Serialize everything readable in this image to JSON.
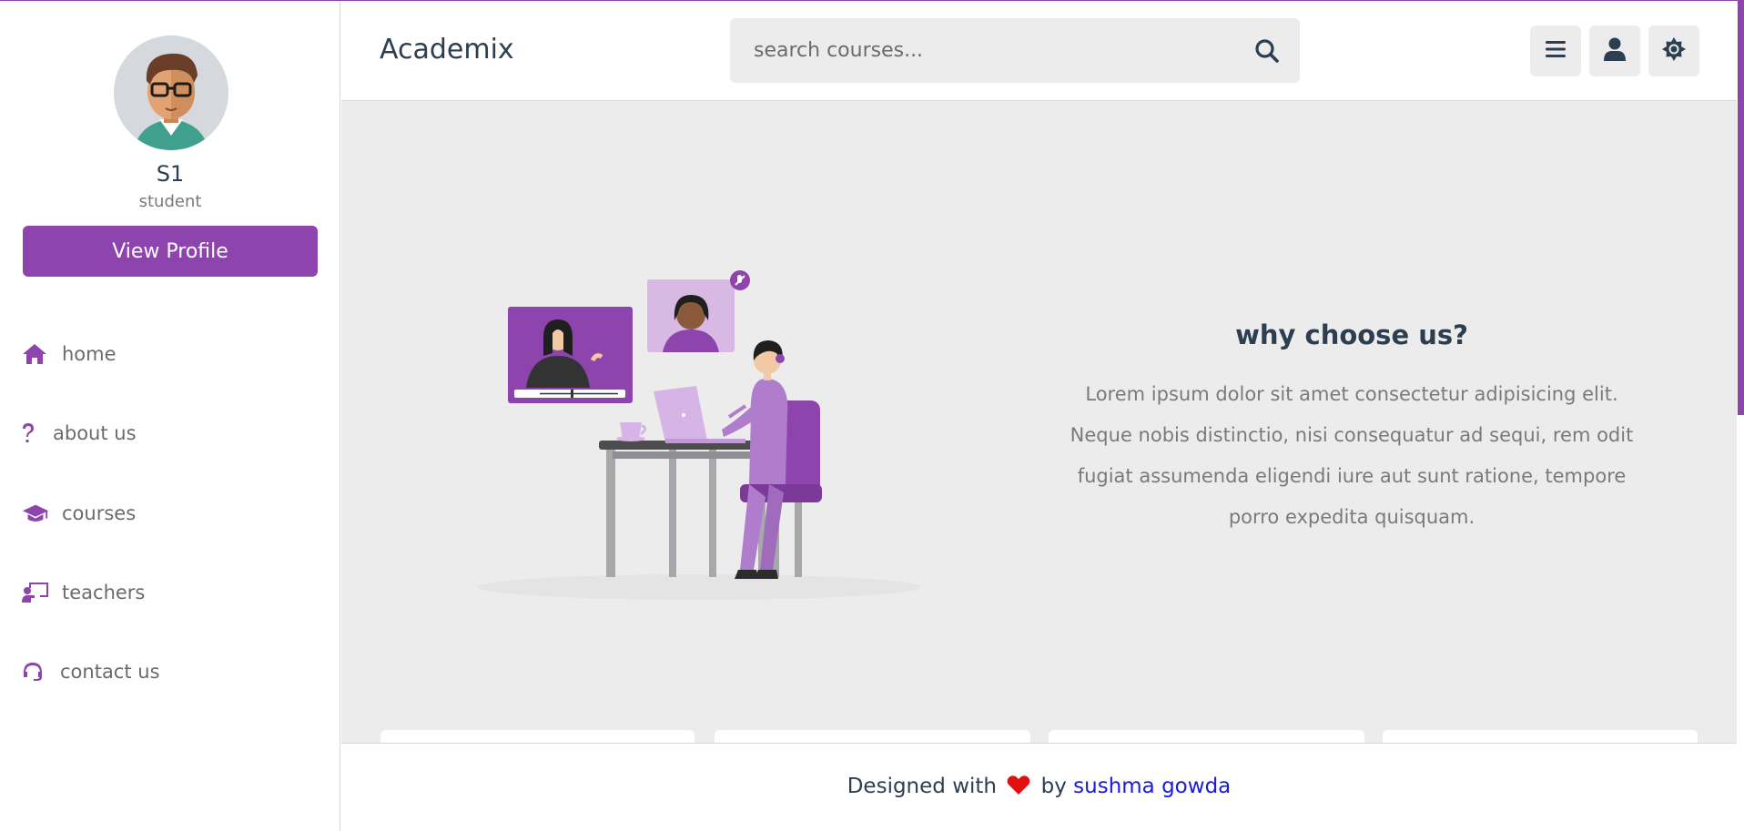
{
  "app": {
    "brand": "Academix"
  },
  "colors": {
    "accent": "#8e44ad",
    "text_dark": "#2c3e50",
    "background": "#ececec",
    "link": "#1a1adb",
    "heart": "#e01010"
  },
  "profile": {
    "avatar_icon": "avatar-man-glasses",
    "name": "S1",
    "role": "student",
    "view_profile_label": "View Profile"
  },
  "sidebar": {
    "items": [
      {
        "label": "home",
        "icon": "home-icon"
      },
      {
        "label": "about us",
        "icon": "question-icon"
      },
      {
        "label": "courses",
        "icon": "graduation-cap-icon"
      },
      {
        "label": "teachers",
        "icon": "chalkboard-teacher-icon"
      },
      {
        "label": "contact us",
        "icon": "headset-icon"
      }
    ]
  },
  "header": {
    "search_placeholder": "search courses...",
    "buttons": [
      {
        "name": "menu",
        "icon": "bars-icon"
      },
      {
        "name": "user",
        "icon": "user-icon"
      },
      {
        "name": "theme",
        "icon": "sun-icon"
      }
    ]
  },
  "main": {
    "illustration": "online-learning-illustration",
    "why_title": "why choose us?",
    "why_text": "Lorem ipsum dolor sit amet consectetur adipisicing elit. Neque nobis distinctio, nisi consequatur ad sequi, rem odit fugiat assumenda eligendi iure aut sunt ratione, tempore porro expedita quisquam."
  },
  "footer": {
    "prefix": "Designed with",
    "heart_icon": "heart-icon",
    "by": "by",
    "author": "sushma gowda"
  }
}
